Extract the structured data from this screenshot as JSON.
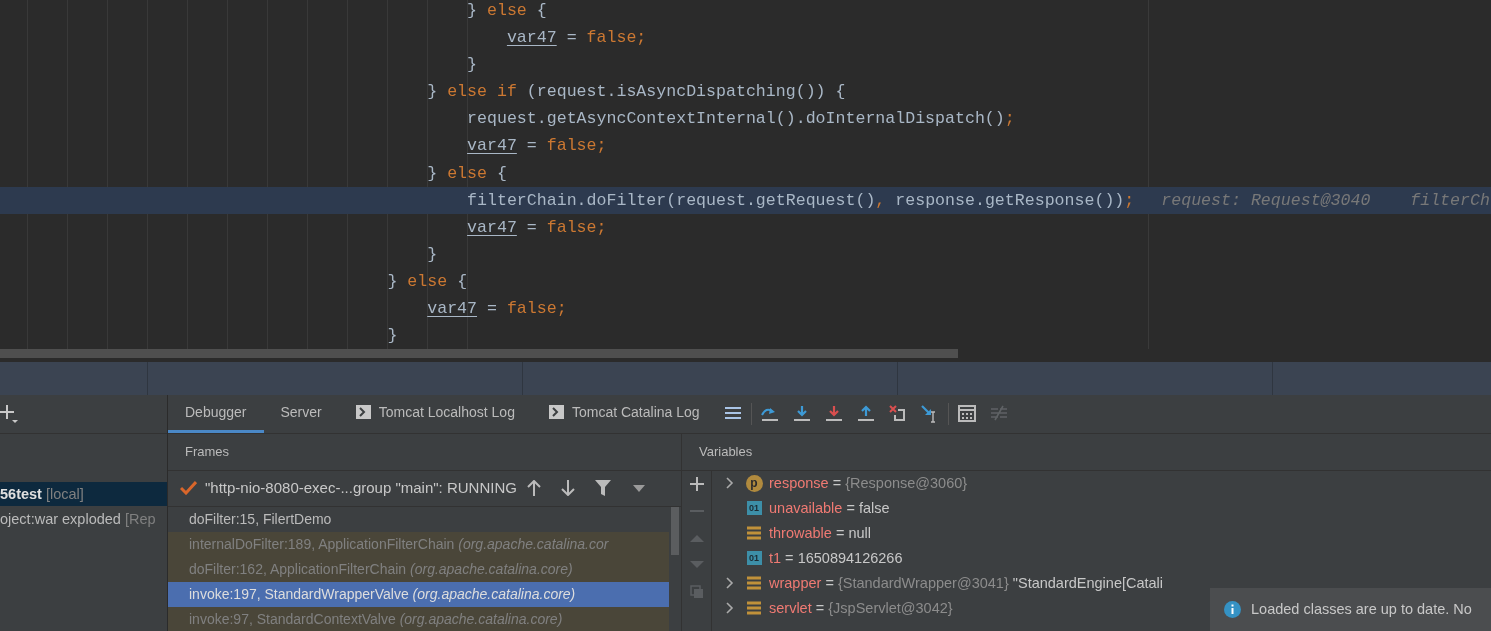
{
  "editor": {
    "lines": [
      {
        "tokens": [
          {
            "text": "                                              } ",
            "kind": "plain"
          },
          {
            "text": "else",
            "kind": "keyword"
          },
          {
            "text": " {",
            "kind": "plain"
          }
        ],
        "highlighted": false
      },
      {
        "tokens": [
          {
            "text": "                                                  var47",
            "kind": "var"
          },
          {
            "text": " = ",
            "kind": "plain"
          },
          {
            "text": "false;",
            "kind": "keyword"
          }
        ],
        "highlighted": false
      },
      {
        "tokens": [
          {
            "text": "                                              }",
            "kind": "plain"
          }
        ],
        "highlighted": false
      },
      {
        "tokens": [
          {
            "text": "                                          } ",
            "kind": "plain"
          },
          {
            "text": "else if",
            "kind": "keyword"
          },
          {
            "text": " (request.isAsyncDispatching()) {",
            "kind": "plain"
          }
        ],
        "highlighted": false
      },
      {
        "tokens": [
          {
            "text": "                                              request.getAsyncContextInternal().doInternalDispatch()",
            "kind": "plain"
          },
          {
            "text": ";",
            "kind": "keyword"
          }
        ],
        "highlighted": false
      },
      {
        "tokens": [
          {
            "text": "                                              var47",
            "kind": "var"
          },
          {
            "text": " = ",
            "kind": "plain"
          },
          {
            "text": "false;",
            "kind": "keyword"
          }
        ],
        "highlighted": false
      },
      {
        "tokens": [
          {
            "text": "                                          } ",
            "kind": "plain"
          },
          {
            "text": "else",
            "kind": "keyword"
          },
          {
            "text": " {",
            "kind": "plain"
          }
        ],
        "highlighted": false
      },
      {
        "tokens": [
          {
            "text": "                                              filterChain.doFilter(request.getRequest()",
            "kind": "plain"
          },
          {
            "text": ",",
            "kind": "keyword"
          },
          {
            "text": " response.getResponse())",
            "kind": "plain"
          },
          {
            "text": ";",
            "kind": "keyword"
          }
        ],
        "highlighted": true,
        "hint": "request: Request@3040    filterCh"
      },
      {
        "tokens": [
          {
            "text": "                                              var47",
            "kind": "var"
          },
          {
            "text": " = ",
            "kind": "plain"
          },
          {
            "text": "false;",
            "kind": "keyword"
          }
        ],
        "highlighted": false
      },
      {
        "tokens": [
          {
            "text": "                                          }",
            "kind": "plain"
          }
        ],
        "highlighted": false
      },
      {
        "tokens": [
          {
            "text": "                                      } ",
            "kind": "plain"
          },
          {
            "text": "else",
            "kind": "keyword"
          },
          {
            "text": " {",
            "kind": "plain"
          }
        ],
        "highlighted": false
      },
      {
        "tokens": [
          {
            "text": "                                          var47",
            "kind": "var"
          },
          {
            "text": " = ",
            "kind": "plain"
          },
          {
            "text": "false;",
            "kind": "keyword"
          }
        ],
        "highlighted": false
      },
      {
        "tokens": [
          {
            "text": "                                      }",
            "kind": "plain"
          }
        ],
        "highlighted": false
      }
    ]
  },
  "sessions": [
    {
      "name": "56test",
      "tag": "[local]",
      "selected": true
    },
    {
      "name": "oject:war exploded",
      "tag": "[Rep",
      "selected": false
    }
  ],
  "tabs": [
    {
      "label": "Debugger",
      "selected": true,
      "console_icon": false
    },
    {
      "label": "Server",
      "selected": false,
      "console_icon": false
    },
    {
      "label": "Tomcat Localhost Log",
      "selected": false,
      "console_icon": true
    },
    {
      "label": "Tomcat Catalina Log",
      "selected": false,
      "console_icon": true
    }
  ],
  "frames": {
    "title": "Frames",
    "thread": "\"http-nio-8080-exec-...group \"main\": RUNNING",
    "items": [
      {
        "label": "doFilter:15, FilertDemo",
        "library": false,
        "selected": false
      },
      {
        "label": "internalDoFilter:189, ApplicationFilterChain",
        "package": "(org.apache.catalina.cor",
        "library": true,
        "selected": false
      },
      {
        "label": "doFilter:162, ApplicationFilterChain",
        "package": "(org.apache.catalina.core)",
        "library": true,
        "selected": false
      },
      {
        "label": "invoke:197, StandardWrapperValve",
        "package": "(org.apache.catalina.core)",
        "library": true,
        "selected": true
      },
      {
        "label": "invoke:97, StandardContextValve",
        "package": "(org.apache.catalina.core)",
        "library": true,
        "selected": false
      }
    ]
  },
  "variables": {
    "title": "Variables",
    "items": [
      {
        "kind": "parameter",
        "badge": "p",
        "name": "response",
        "operator": "=",
        "ref": "{Response@3060}",
        "expandable": true
      },
      {
        "kind": "primitive",
        "badge": "01",
        "name": "unavailable",
        "operator": "=",
        "value": "false",
        "expandable": false
      },
      {
        "kind": "field",
        "name": "throwable",
        "operator": "=",
        "value": "null",
        "expandable": false
      },
      {
        "kind": "primitive",
        "badge": "01",
        "name": "t1",
        "operator": "=",
        "value": "1650894126266",
        "expandable": false
      },
      {
        "kind": "field",
        "name": "wrapper",
        "operator": "=",
        "ref": "{StandardWrapper@3041}",
        "value": "\"StandardEngine[Catali",
        "expandable": true
      },
      {
        "kind": "field",
        "name": "servlet",
        "operator": "=",
        "ref": "{JspServlet@3042}",
        "expandable": true
      }
    ]
  },
  "notification": {
    "text": "Loaded classes are up to date. No"
  }
}
